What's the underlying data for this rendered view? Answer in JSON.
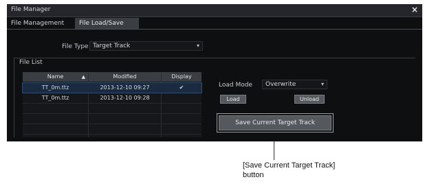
{
  "window": {
    "title": "File Manager",
    "close_glyph": "×"
  },
  "tabs": [
    {
      "label": "File Management",
      "active": false
    },
    {
      "label": "File Load/Save",
      "active": true
    }
  ],
  "file_type": {
    "label": "File Type",
    "value": "Target Track"
  },
  "file_list": {
    "label": "File List",
    "columns": [
      "Name",
      "Modified",
      "Display"
    ],
    "rows": [
      {
        "name": "TT_0m.ttz",
        "modified": "2013-12-10 09:27",
        "display": "✔",
        "selected": true
      },
      {
        "name": "TT_0m.ttz",
        "modified": "2013-12-10 09:28",
        "display": "",
        "selected": false
      }
    ]
  },
  "load_mode": {
    "label": "Load Mode",
    "value": "Overwrite"
  },
  "buttons": {
    "load": "Load",
    "unload": "Unload",
    "save_current": "Save Current Target Track"
  },
  "caption": {
    "line1": "[Save Current Target Track]",
    "line2": "button"
  },
  "colors": {
    "window_bg": "#0e0f11",
    "active_tab": "#3a3d42",
    "button_bg": "#55585d",
    "selected_row": "#1a2a40"
  }
}
